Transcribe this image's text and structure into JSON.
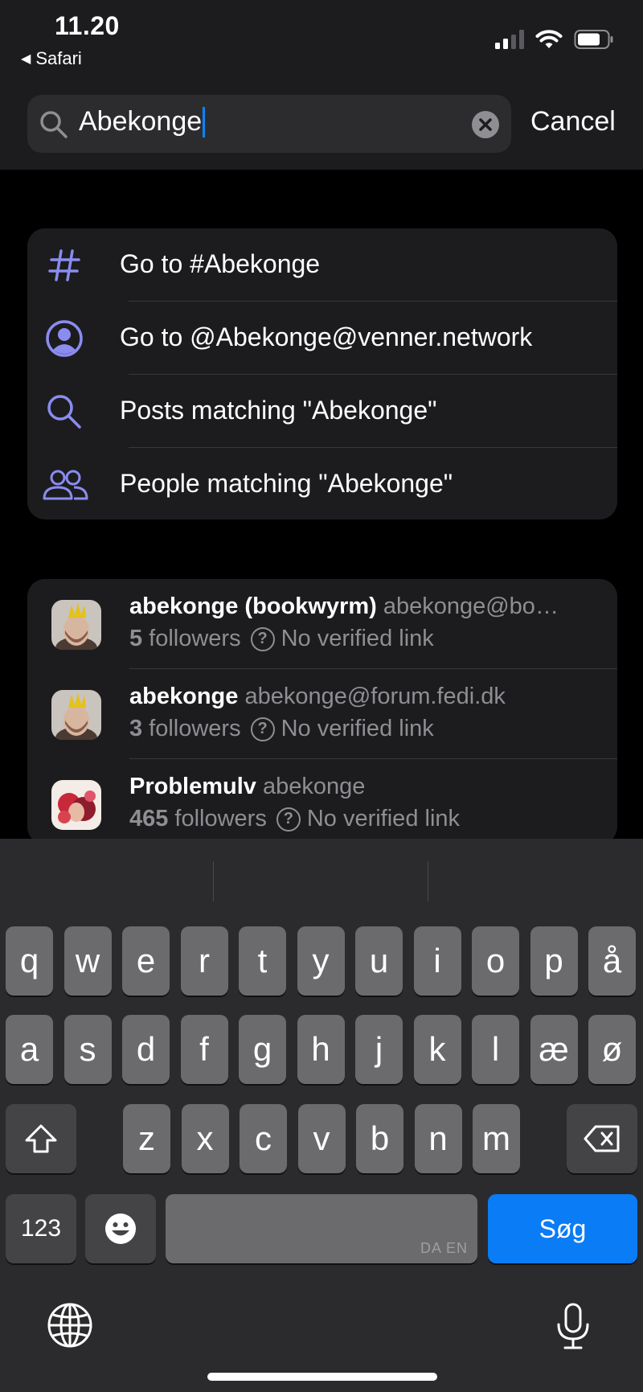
{
  "status_bar": {
    "time": "11.20",
    "back_app": "Safari",
    "back_arrow": "◀"
  },
  "search": {
    "value": "Abekonge",
    "cancel_label": "Cancel"
  },
  "suggestions": [
    {
      "icon": "hashtag-icon",
      "label": "Go to #Abekonge"
    },
    {
      "icon": "person-circle-icon",
      "label": "Go to @Abekonge@venner.network"
    },
    {
      "icon": "search-icon",
      "label": "Posts matching \"Abekonge\""
    },
    {
      "icon": "people-icon",
      "label": "People matching \"Abekonge\""
    }
  ],
  "people": [
    {
      "display_name": "abekonge (bookwyrm)",
      "handle": "abekonge@bo…",
      "followers": "5",
      "followers_label": "followers",
      "verification": "No verified link"
    },
    {
      "display_name": "abekonge",
      "handle": "abekonge@forum.fedi.dk",
      "followers": "3",
      "followers_label": "followers",
      "verification": "No verified link"
    },
    {
      "display_name": "Problemulv",
      "handle": "abekonge",
      "followers": "465",
      "followers_label": "followers",
      "verification": "No verified link"
    }
  ],
  "keyboard": {
    "row1": [
      "q",
      "w",
      "e",
      "r",
      "t",
      "y",
      "u",
      "i",
      "o",
      "p",
      "å"
    ],
    "row2": [
      "a",
      "s",
      "d",
      "f",
      "g",
      "h",
      "j",
      "k",
      "l",
      "æ",
      "ø"
    ],
    "row3": [
      "z",
      "x",
      "c",
      "v",
      "b",
      "n",
      "m"
    ],
    "numbers_label": "123",
    "space_lang": "DA EN",
    "return_label": "Søg"
  },
  "colors": {
    "accent": "#8a8cf0",
    "return_key": "#0a7cf5",
    "card": "#1c1c1e"
  }
}
